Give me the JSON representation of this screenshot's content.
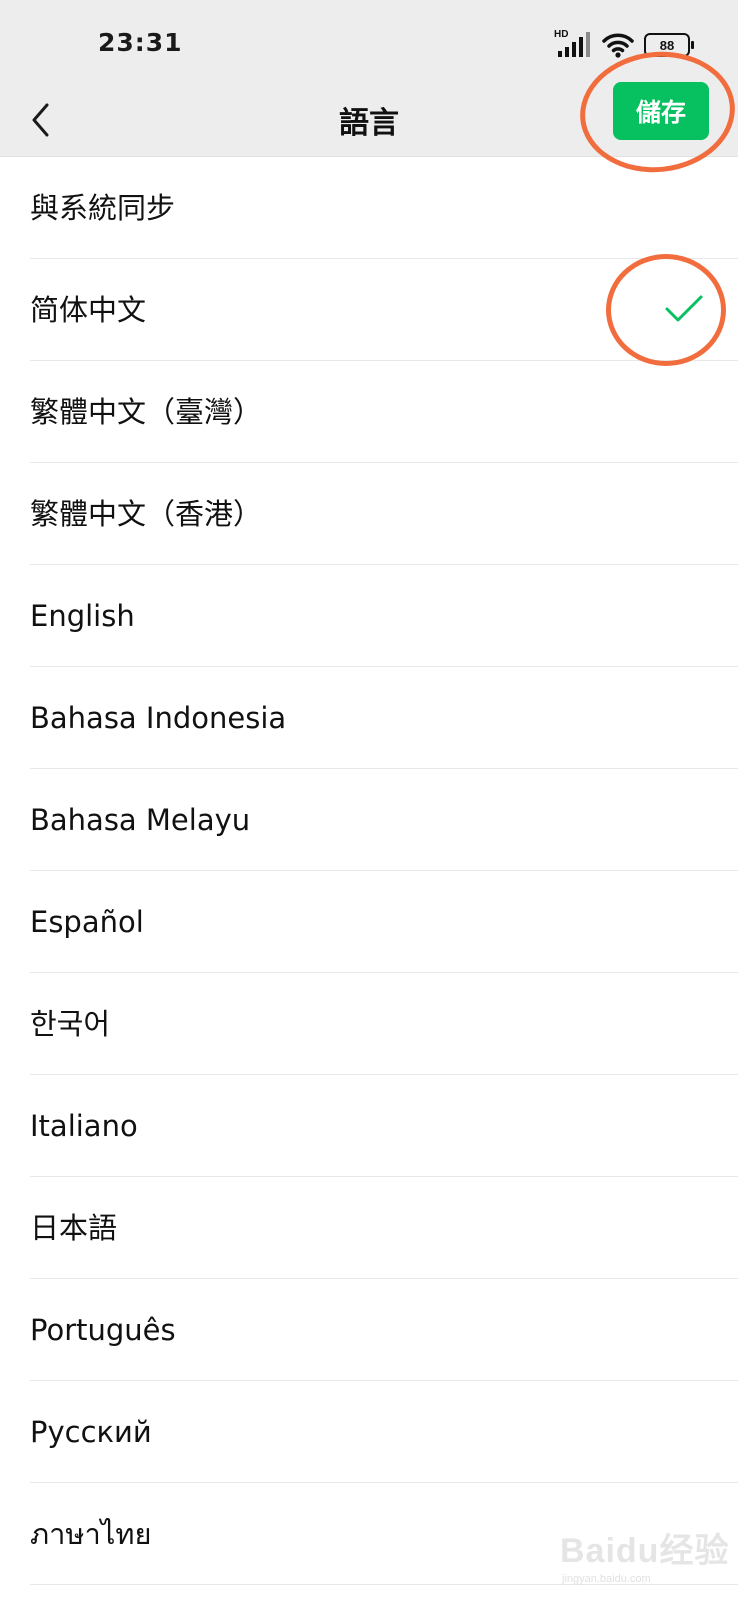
{
  "status_bar": {
    "time": "23:31",
    "network_label": "HD",
    "battery_level": "88"
  },
  "header": {
    "title": "語言",
    "save_label": "儲存",
    "back_icon": "chevron-left-icon"
  },
  "languages": {
    "items": [
      {
        "label": "與系統同步",
        "selected": false
      },
      {
        "label": "简体中文",
        "selected": true
      },
      {
        "label": "繁體中文（臺灣）",
        "selected": false
      },
      {
        "label": "繁體中文（香港）",
        "selected": false
      },
      {
        "label": "English",
        "selected": false
      },
      {
        "label": "Bahasa Indonesia",
        "selected": false
      },
      {
        "label": "Bahasa Melayu",
        "selected": false
      },
      {
        "label": "Español",
        "selected": false
      },
      {
        "label": "한국어",
        "selected": false
      },
      {
        "label": "Italiano",
        "selected": false
      },
      {
        "label": "日本語",
        "selected": false
      },
      {
        "label": "Português",
        "selected": false
      },
      {
        "label": "Русский",
        "selected": false
      },
      {
        "label": "ภาษาไทย",
        "selected": false
      }
    ]
  },
  "watermark": {
    "brand": "Baidu经验",
    "url": "jingyan.baidu.com"
  },
  "colors": {
    "accent_green": "#07c160",
    "annotation_orange": "#f26d3d",
    "header_bg": "#ededed"
  }
}
